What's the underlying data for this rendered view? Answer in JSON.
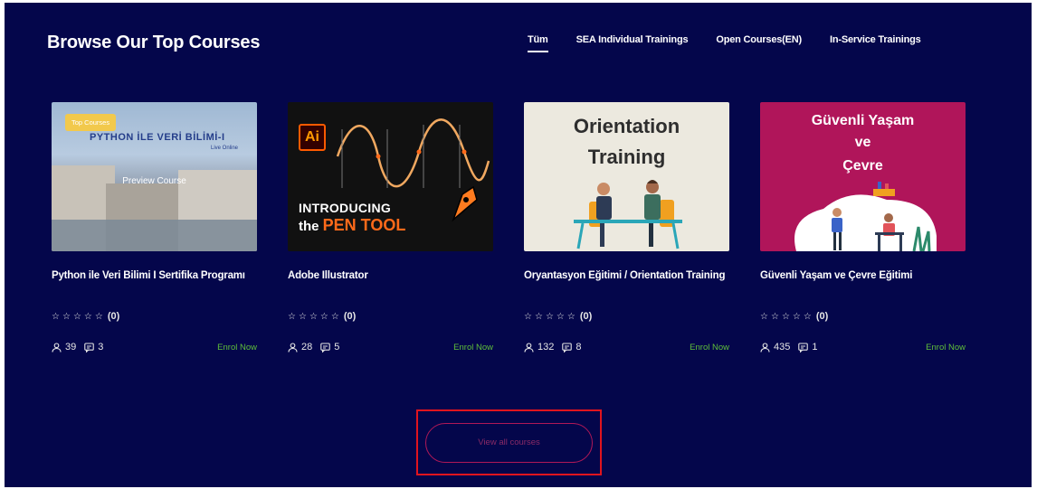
{
  "section": {
    "title": "Browse Our Top Courses"
  },
  "tabs": [
    {
      "label": "Tüm",
      "active": true
    },
    {
      "label": "SEA Individual Trainings",
      "active": false
    },
    {
      "label": "Open Courses(EN)",
      "active": false
    },
    {
      "label": "In-Service Trainings",
      "active": false
    }
  ],
  "courses": [
    {
      "title": "Python ile Veri Bilimi I Sertifika Programı",
      "badge": "Top Courses",
      "thumb_text": "PYTHON İLE VERİ BİLİMİ-I",
      "thumb_subtext": "Live Online",
      "preview_label": "Preview Course",
      "rating": 0,
      "rating_count": "(0)",
      "students": "39",
      "lessons": "3",
      "enroll_label": "Enrol Now"
    },
    {
      "title": "Adobe Illustrator",
      "thumb_logo": "Ai",
      "thumb_line1": "INTRODUCING",
      "thumb_line2_prefix": "the",
      "thumb_line2_highlight": "PEN TOOL",
      "rating": 0,
      "rating_count": "(0)",
      "students": "28",
      "lessons": "5",
      "enroll_label": "Enrol Now"
    },
    {
      "title": "Oryantasyon Eğitimi / Orientation Training",
      "thumb_line1": "Orientation",
      "thumb_line2": "Training",
      "rating": 0,
      "rating_count": "(0)",
      "students": "132",
      "lessons": "8",
      "enroll_label": "Enrol Now"
    },
    {
      "title": "Güvenli Yaşam ve Çevre Eğitimi",
      "thumb_line1": "Güvenli Yaşam",
      "thumb_line2": "ve",
      "thumb_line3": "Çevre",
      "rating": 0,
      "rating_count": "(0)",
      "students": "435",
      "lessons": "1",
      "enroll_label": "Enrol Now"
    }
  ],
  "view_all": {
    "label": "View all courses"
  },
  "colors": {
    "background": "#04064b",
    "enroll": "#5fbf3a",
    "badge": "#f2c94c",
    "view_all_border": "#b01857",
    "highlight": "#e0141e"
  }
}
